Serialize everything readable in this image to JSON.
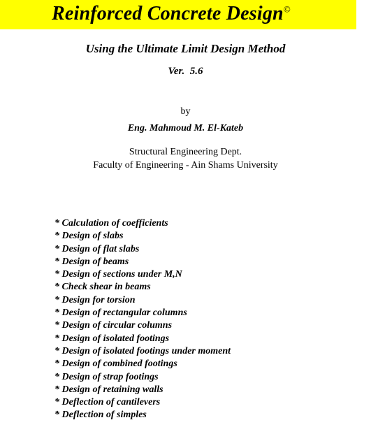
{
  "page": {
    "background_color": "#ffffff",
    "text_color": "#000000"
  },
  "banner": {
    "background_color": "#ffff00",
    "title": "Reinforced Concrete Design",
    "copyright_symbol": "©"
  },
  "heading": {
    "subtitle": "Using the Ultimate Limit Design Method",
    "version": "Ver.  5.6"
  },
  "author": {
    "byline": "by",
    "name": "Eng. Mahmoud M. El-Kateb"
  },
  "affiliation": {
    "lines": [
      "Structural Engineering Dept.",
      "Faculty of Engineering - Ain Shams University"
    ]
  },
  "features": {
    "items": [
      "* Calculation of coefficients",
      "* Design of slabs",
      "* Design of flat slabs",
      "* Design of beams",
      "* Design of sections under M,N",
      "* Check shear in beams",
      "* Design for torsion",
      "* Design of rectangular columns",
      "* Design of circular columns",
      "* Design of isolated footings",
      "* Design of isolated footings under moment",
      "* Design of combined footings",
      "* Design of strap footings",
      "* Design of retaining walls",
      "* Deflection of cantilevers",
      "* Deflection of simples"
    ]
  }
}
